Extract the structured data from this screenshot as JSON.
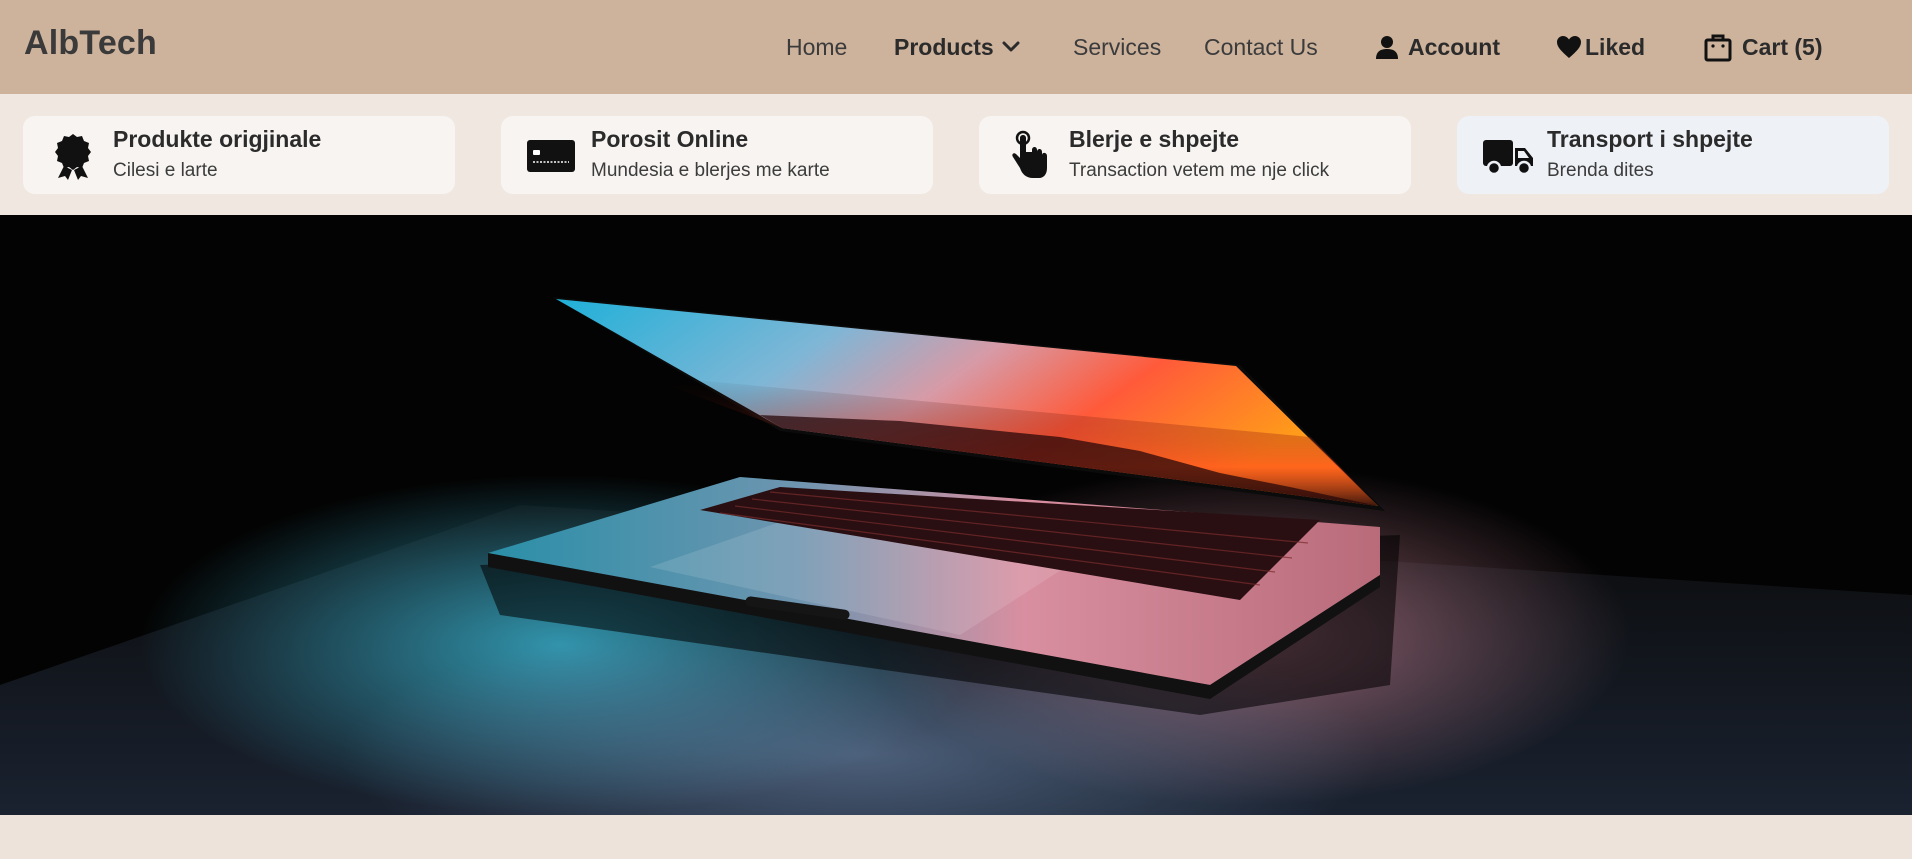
{
  "brand": {
    "name": "AlbTech"
  },
  "nav": {
    "home": "Home",
    "products": "Products",
    "services": "Services",
    "contact": "Contact Us",
    "account": "Account",
    "liked": "Liked",
    "cart": "Cart (5)"
  },
  "features": [
    {
      "icon": "award-badge-icon",
      "title": "Produkte origjinale",
      "subtitle": "Cilesi e larte"
    },
    {
      "icon": "credit-card-icon",
      "title": "Porosit Online",
      "subtitle": "Mundesia e blerjes me karte"
    },
    {
      "icon": "pointer-hand-icon",
      "title": "Blerje e shpejte",
      "subtitle": "Transaction vetem me nje click"
    },
    {
      "icon": "delivery-truck-icon",
      "title": "Transport i shpejte",
      "subtitle": "Brenda dites"
    }
  ],
  "colors": {
    "header_bg": "#cdb29c",
    "page_bg": "#ede3db",
    "card_bg": "#f8f4f1",
    "card_highlight_bg": "#eef2f7"
  }
}
